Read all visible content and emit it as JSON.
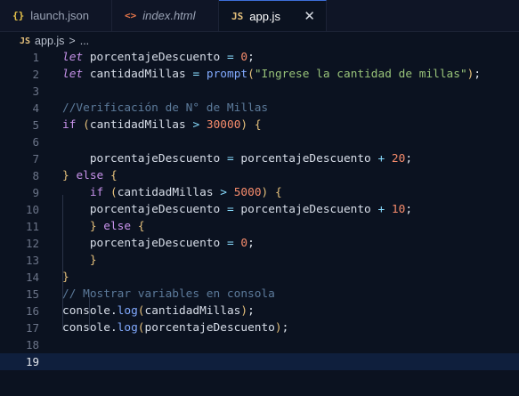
{
  "tabs": [
    {
      "icon": "{}",
      "label": "launch.json",
      "icon_color": "#e8c44a"
    },
    {
      "icon": "<>",
      "label": "index.html",
      "icon_color": "#e8774a"
    },
    {
      "icon": "JS",
      "label": "app.js",
      "icon_color": "#e5c07b"
    }
  ],
  "close_icon": "✕",
  "breadcrumb": {
    "icon": "JS",
    "file": "app.js",
    "sep": ">",
    "more": "..."
  },
  "colors": {
    "keyword": "#c792ea",
    "variable": "#d8dee9",
    "string": "#98c379",
    "number": "#f78c6c",
    "comment": "#5c7a9a",
    "function": "#82aaff",
    "paren": "#e5c07b",
    "operator": "#89ddff",
    "punct": "#e2e8f0"
  },
  "code_lines": [
    {
      "n": "1",
      "tokens": [
        [
          "kw-italic",
          "let"
        ],
        [
          "plain",
          " "
        ],
        [
          "var",
          "porcentajeDescuento"
        ],
        [
          "plain",
          " "
        ],
        [
          "op",
          "="
        ],
        [
          "plain",
          " "
        ],
        [
          "num",
          "0"
        ],
        [
          "punct",
          ";"
        ]
      ]
    },
    {
      "n": "2",
      "tokens": [
        [
          "kw-italic",
          "let"
        ],
        [
          "plain",
          " "
        ],
        [
          "var",
          "cantidadMillas"
        ],
        [
          "plain",
          " "
        ],
        [
          "op",
          "="
        ],
        [
          "plain",
          " "
        ],
        [
          "fn",
          "prompt"
        ],
        [
          "paren",
          "("
        ],
        [
          "str",
          "\"Ingrese la cantidad de millas\""
        ],
        [
          "paren",
          ")"
        ],
        [
          "punct",
          ";"
        ]
      ]
    },
    {
      "n": "3",
      "tokens": []
    },
    {
      "n": "4",
      "tokens": [
        [
          "comment",
          "//Verificación de N° de Millas"
        ]
      ]
    },
    {
      "n": "5",
      "tokens": [
        [
          "kw",
          "if"
        ],
        [
          "plain",
          " "
        ],
        [
          "paren",
          "("
        ],
        [
          "var",
          "cantidadMillas"
        ],
        [
          "plain",
          " "
        ],
        [
          "op",
          ">"
        ],
        [
          "plain",
          " "
        ],
        [
          "num",
          "30000"
        ],
        [
          "paren",
          ")"
        ],
        [
          "plain",
          " "
        ],
        [
          "paren",
          "{"
        ]
      ]
    },
    {
      "n": "6",
      "tokens": []
    },
    {
      "n": "7",
      "tokens": [
        [
          "plain",
          "    "
        ],
        [
          "var",
          "porcentajeDescuento"
        ],
        [
          "plain",
          " "
        ],
        [
          "op",
          "="
        ],
        [
          "plain",
          " "
        ],
        [
          "var",
          "porcentajeDescuento"
        ],
        [
          "plain",
          " "
        ],
        [
          "op",
          "+"
        ],
        [
          "plain",
          " "
        ],
        [
          "num",
          "20"
        ],
        [
          "punct",
          ";"
        ]
      ]
    },
    {
      "n": "8",
      "tokens": [
        [
          "paren",
          "}"
        ],
        [
          "plain",
          " "
        ],
        [
          "kw",
          "else"
        ],
        [
          "plain",
          " "
        ],
        [
          "paren",
          "{"
        ]
      ]
    },
    {
      "n": "9",
      "tokens": [
        [
          "plain",
          "    "
        ],
        [
          "kw",
          "if"
        ],
        [
          "plain",
          " "
        ],
        [
          "paren",
          "("
        ],
        [
          "var",
          "cantidadMillas"
        ],
        [
          "plain",
          " "
        ],
        [
          "op",
          ">"
        ],
        [
          "plain",
          " "
        ],
        [
          "num",
          "5000"
        ],
        [
          "paren",
          ")"
        ],
        [
          "plain",
          " "
        ],
        [
          "paren",
          "{"
        ]
      ]
    },
    {
      "n": "10",
      "tokens": [
        [
          "plain",
          "    "
        ],
        [
          "var",
          "porcentajeDescuento"
        ],
        [
          "plain",
          " "
        ],
        [
          "op",
          "="
        ],
        [
          "plain",
          " "
        ],
        [
          "var",
          "porcentajeDescuento"
        ],
        [
          "plain",
          " "
        ],
        [
          "op",
          "+"
        ],
        [
          "plain",
          " "
        ],
        [
          "num",
          "10"
        ],
        [
          "punct",
          ";"
        ]
      ]
    },
    {
      "n": "11",
      "tokens": [
        [
          "plain",
          "    "
        ],
        [
          "paren",
          "}"
        ],
        [
          "plain",
          " "
        ],
        [
          "kw",
          "else"
        ],
        [
          "plain",
          " "
        ],
        [
          "paren",
          "{"
        ]
      ]
    },
    {
      "n": "12",
      "tokens": [
        [
          "plain",
          "    "
        ],
        [
          "var",
          "porcentajeDescuento"
        ],
        [
          "plain",
          " "
        ],
        [
          "op",
          "="
        ],
        [
          "plain",
          " "
        ],
        [
          "num",
          "0"
        ],
        [
          "punct",
          ";"
        ]
      ]
    },
    {
      "n": "13",
      "tokens": [
        [
          "plain",
          "    "
        ],
        [
          "paren",
          "}"
        ]
      ]
    },
    {
      "n": "14",
      "tokens": [
        [
          "paren",
          "}"
        ]
      ]
    },
    {
      "n": "15",
      "tokens": [
        [
          "comment",
          "// Mostrar variables en consola"
        ]
      ]
    },
    {
      "n": "16",
      "tokens": [
        [
          "var",
          "console"
        ],
        [
          "punct",
          "."
        ],
        [
          "fn",
          "log"
        ],
        [
          "paren",
          "("
        ],
        [
          "var",
          "cantidadMillas"
        ],
        [
          "paren",
          ")"
        ],
        [
          "punct",
          ";"
        ]
      ]
    },
    {
      "n": "17",
      "tokens": [
        [
          "var",
          "console"
        ],
        [
          "punct",
          "."
        ],
        [
          "fn",
          "log"
        ],
        [
          "paren",
          "("
        ],
        [
          "var",
          "porcentajeDescuento"
        ],
        [
          "paren",
          ")"
        ],
        [
          "punct",
          ";"
        ]
      ]
    },
    {
      "n": "18",
      "tokens": []
    },
    {
      "n": "19",
      "tokens": [],
      "current": true
    }
  ]
}
